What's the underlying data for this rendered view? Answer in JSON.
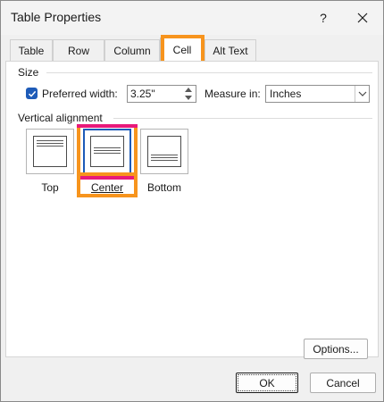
{
  "dialog": {
    "title": "Table Properties",
    "help_label": "?",
    "close_icon": "close-icon"
  },
  "tabs": [
    {
      "label": "Table",
      "active": false
    },
    {
      "label": "Row",
      "active": false
    },
    {
      "label": "Column",
      "active": false
    },
    {
      "label": "Cell",
      "active": true
    },
    {
      "label": "Alt Text",
      "active": false
    }
  ],
  "size": {
    "group_label": "Size",
    "preferred_width_label": "Preferred width:",
    "preferred_width_checked": true,
    "preferred_width_value": "3.25\"",
    "measure_in_label": "Measure in:",
    "measure_in_value": "Inches"
  },
  "vertical_alignment": {
    "group_label": "Vertical alignment",
    "options": [
      {
        "label": "Top",
        "selected": false
      },
      {
        "label": "Center",
        "selected": true
      },
      {
        "label": "Bottom",
        "selected": false
      }
    ]
  },
  "buttons": {
    "options": "Options...",
    "ok": "OK",
    "cancel": "Cancel"
  },
  "colors": {
    "accent": "#1e5bb8",
    "highlight_pink": "#e8197a",
    "highlight_orange": "#f7941d"
  }
}
